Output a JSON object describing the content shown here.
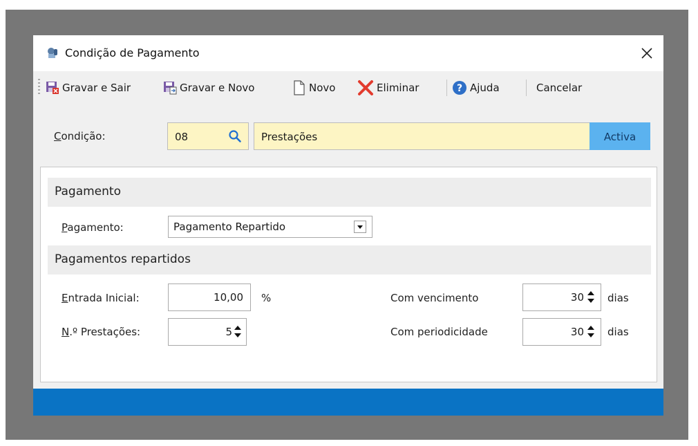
{
  "window": {
    "title": "Condição de Pagamento",
    "close_icon": "close-icon",
    "app_icon": "payment-hand-icon"
  },
  "toolbar": {
    "items": [
      {
        "label": "Gravar e Sair",
        "icon": "save-exit-icon"
      },
      {
        "label": "Gravar e Novo",
        "icon": "save-new-icon"
      },
      {
        "label": "Novo",
        "icon": "new-document-icon"
      },
      {
        "label": "Eliminar",
        "icon": "delete-x-icon"
      },
      {
        "label": "Ajuda",
        "icon": "help-icon"
      },
      {
        "label": "Cancelar"
      }
    ]
  },
  "header": {
    "label_accesskey": "C",
    "label_rest": "ondição:",
    "code": "08",
    "description": "Prestações",
    "status_button": "Activa"
  },
  "sections": {
    "payment": {
      "title": "Pagamento",
      "label_accesskey": "P",
      "label_rest": "agamento:",
      "selected": "Pagamento Repartido"
    },
    "split": {
      "title": "Pagamentos repartidos",
      "entrada_accesskey": "E",
      "entrada_rest": "ntrada Inicial:",
      "entrada_value": "10,00",
      "entrada_unit": "%",
      "prestacoes_accesskey": "N",
      "prestacoes_rest": ".º Prestações:",
      "prestacoes_value": "5",
      "vencimento_label": "Com vencimento",
      "vencimento_value": "30",
      "vencimento_unit": "dias",
      "periodicidade_label": "Com periodicidade",
      "periodicidade_value": "30",
      "periodicidade_unit": "dias"
    }
  },
  "colors": {
    "accent_blue": "#0a73c4",
    "button_blue": "#5bb2ef",
    "input_yellow": "#fdf5c4",
    "backdrop_gray": "#777777"
  }
}
